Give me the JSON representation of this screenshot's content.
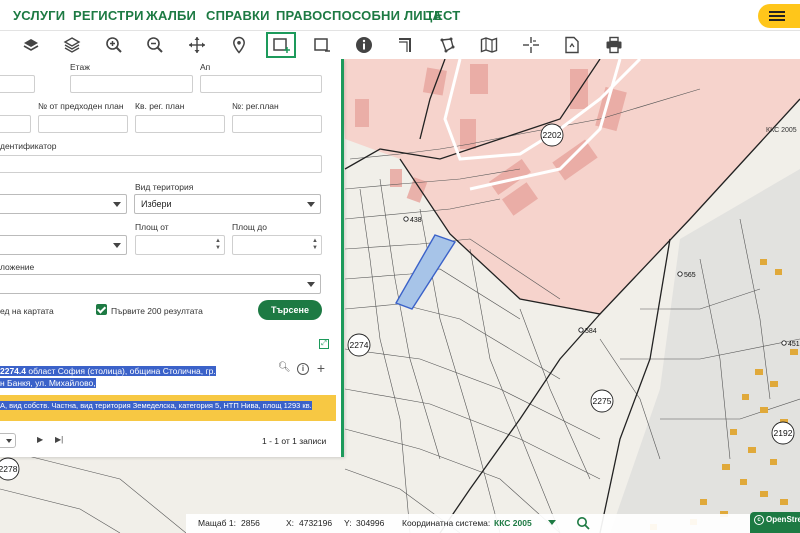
{
  "nav": {
    "items": [
      "УСЛУГИ",
      "РЕГИСТРИ",
      "ЖАЛБИ",
      "СПРАВКИ",
      "ПРАВОСПОСОБНИ ЛИЦА",
      "ТЕСТ"
    ]
  },
  "toolbar": {
    "tools": [
      "layers-icon",
      "layer-stack-icon",
      "zoom-in-icon",
      "zoom-out-icon",
      "pan-icon",
      "location-pin-icon",
      "select-rectangle-icon",
      "select-area-icon",
      "info-icon",
      "edit-corner-icon",
      "draw-polygon-icon",
      "map-icon",
      "crosshair-icon",
      "document-icon",
      "print-icon"
    ],
    "active_index": 6
  },
  "panel": {
    "labels": {
      "floor": "Етаж",
      "apartment": "Ап",
      "prev_plan_no": "№ от предходен план",
      "quarter_reg_plan": "Кв. рег. план",
      "reg_plan_no": "№: рег.план",
      "identifier": "дентификатор",
      "territory_type": "Вид територия",
      "area_from": "Площ от",
      "area_to": "Площ до",
      "location": "ложение",
      "on_map": "ед на картата",
      "first_200": "Първите 200 резултата"
    },
    "territory_select_value": "Избери",
    "search_button": "Търсене",
    "result": {
      "line1_bold": "2274.4",
      "line1_text": " област София (столица), община Столична, гр.",
      "line2_text": "н Банкя, ул. Михайлово,",
      "line3_text": "А, вид собств. Частна, вид територия Земеделска, категория 5, НТП Нива, площ 1293 кв."
    },
    "pager": {
      "summary": "1 - 1 от 1 записи"
    }
  },
  "map": {
    "kks_label": "ККС 2005",
    "parcel_labels": [
      "2202",
      "2274",
      "2275",
      "2278",
      "2192"
    ],
    "point_labels": [
      "438",
      "584",
      "565",
      "451"
    ]
  },
  "statusbar": {
    "scale_label": "Мащаб 1:",
    "scale_value": "2856",
    "x_label": "X:",
    "x_value": "4732196",
    "y_label": "Y:",
    "y_value": "304996",
    "coord_system_label": "Координатна система:",
    "coord_system_value": "ККС 2005"
  },
  "attribution": "OpenStre",
  "colors": {
    "brand_green": "#1d7a43",
    "accent_yellow": "#ffc61a",
    "selection_blue": "#3b62c9",
    "urban_pink": "#f6d3cc"
  }
}
